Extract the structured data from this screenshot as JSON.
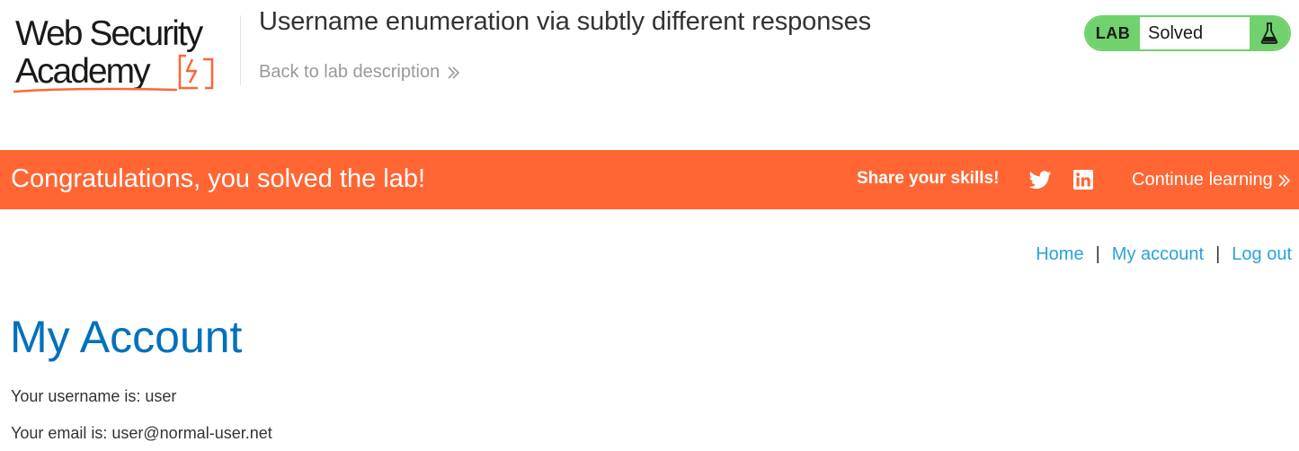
{
  "header": {
    "logo": {
      "line1": "Web Security",
      "line2": "Academy",
      "accent_color": "#ff6633"
    },
    "lab_title": "Username enumeration via subtly different responses",
    "back_link": "Back to lab description",
    "lab_status": {
      "tag": "LAB",
      "state": "Solved",
      "icon": "flask-icon",
      "color": "#70d16d"
    }
  },
  "banner": {
    "message": "Congratulations, you solved the lab!",
    "share_label": "Share your skills!",
    "share_icons": [
      "twitter-icon",
      "linkedin-icon"
    ],
    "continue_label": "Continue learning",
    "color": "#ff6633"
  },
  "nav": {
    "items": [
      {
        "label": "Home"
      },
      {
        "label": "My account"
      },
      {
        "label": "Log out"
      }
    ],
    "separator": "|",
    "link_color": "#29a3d9"
  },
  "main": {
    "heading": "My Account",
    "username_line": "Your username is: user",
    "email_line": "Your email is: user@normal-user.net",
    "heading_color": "#0071bc"
  }
}
